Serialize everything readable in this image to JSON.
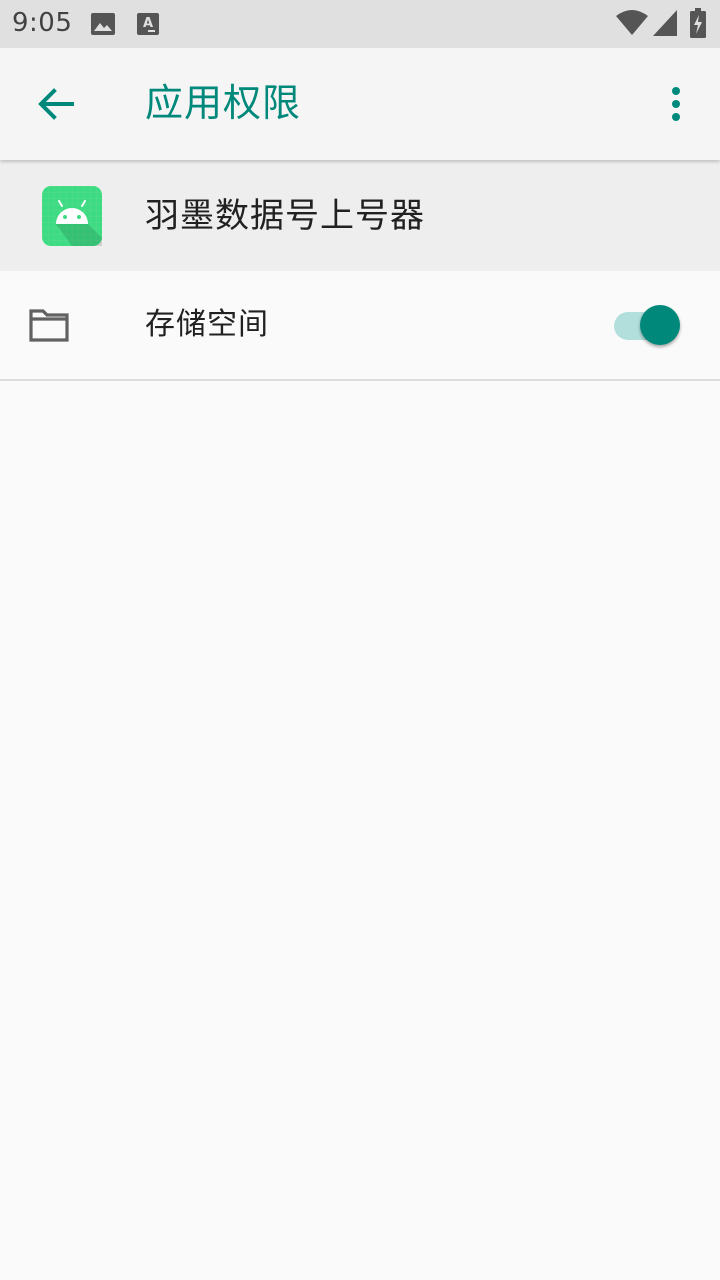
{
  "status_bar": {
    "time": "9:05",
    "icons": [
      "image-icon",
      "font-icon",
      "wifi-icon",
      "signal-icon",
      "battery-charging-icon"
    ]
  },
  "app_bar": {
    "title": "应用权限",
    "accent_color": "#00897b"
  },
  "app": {
    "name": "羽墨数据号上号器",
    "icon": "android-app-icon"
  },
  "permissions": [
    {
      "label": "存储空间",
      "icon": "folder-icon",
      "enabled": true
    }
  ]
}
